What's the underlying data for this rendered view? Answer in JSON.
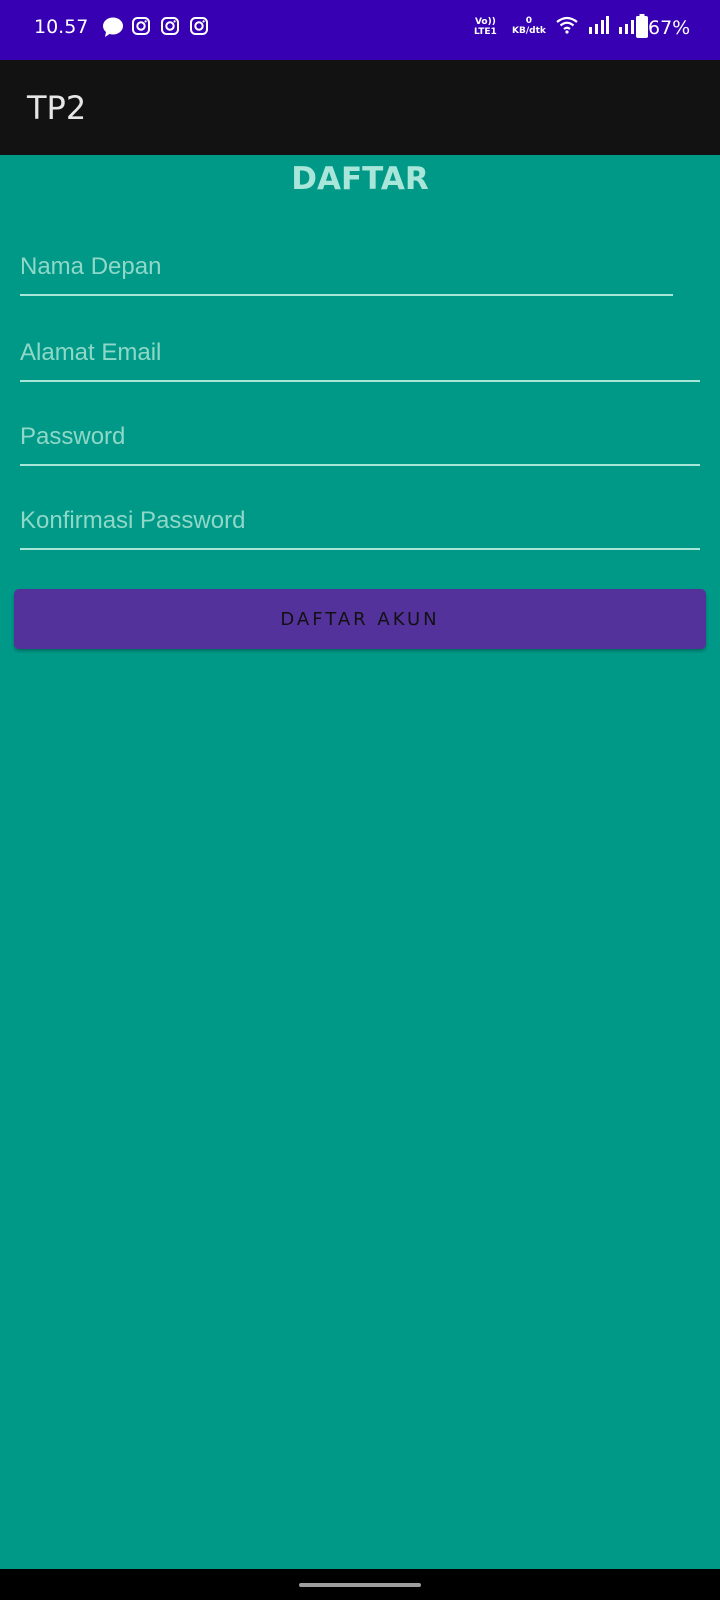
{
  "status_bar": {
    "time": "10.57",
    "notifications": [
      "chat-bubble-icon",
      "instagram-icon",
      "instagram-icon",
      "instagram-icon"
    ],
    "volte_line1": "Vo))",
    "volte_line2": "LTE1",
    "net_speed_value": "0",
    "net_speed_unit": "KB/dtk",
    "battery_percent": "67%",
    "background": "#3700b3"
  },
  "app_bar": {
    "title": "TP2",
    "background": "#121212"
  },
  "form": {
    "heading": "DAFTAR",
    "first_name_placeholder": "Nama Depan",
    "email_placeholder": "Alamat Email",
    "password_placeholder": "Password",
    "confirm_password_placeholder": "Konfirmasi Password",
    "submit_label": "DAFTAR AKUN"
  },
  "colors": {
    "page_background": "#009988",
    "heading": "#a8e6d9",
    "button": "#54329b"
  }
}
